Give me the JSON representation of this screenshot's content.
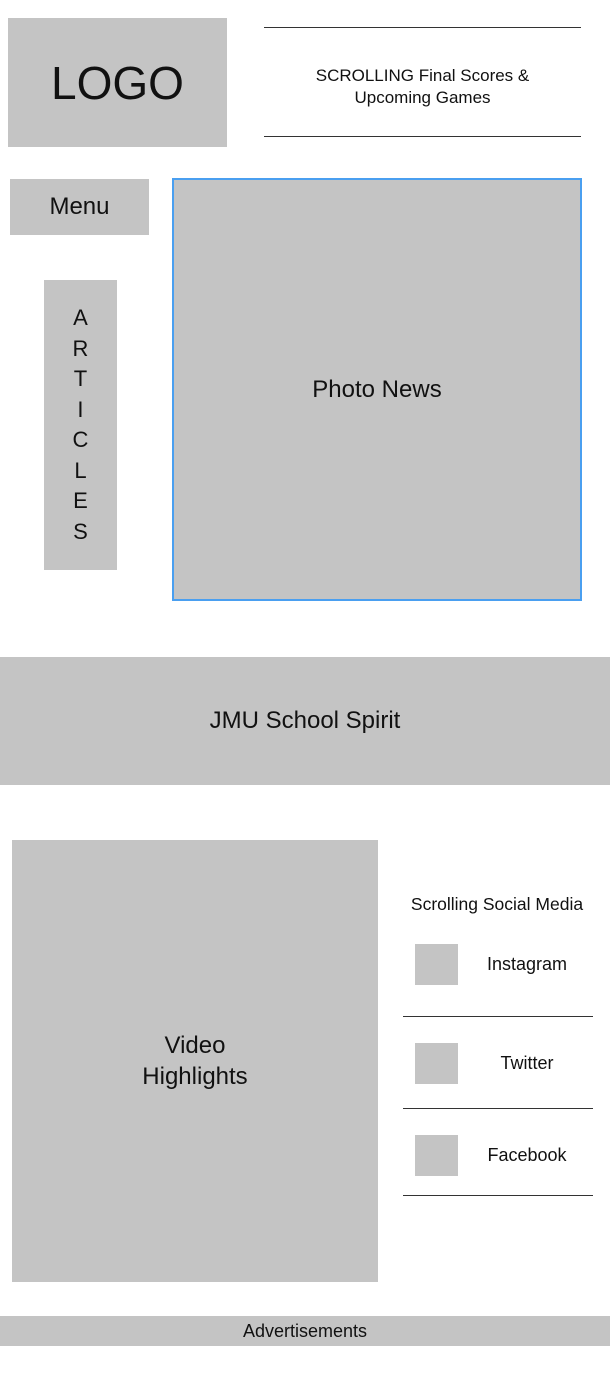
{
  "header": {
    "logo_label": "LOGO",
    "ticker_line1": "SCROLLING Final Scores &",
    "ticker_line2": "Upcoming Games"
  },
  "sidebar": {
    "menu_label": "Menu",
    "articles_label": "ARTICLES"
  },
  "main": {
    "photo_news_label": "Photo News",
    "spirit_label": "JMU School Spirit",
    "video_line1": "Video",
    "video_line2": "Highlights"
  },
  "social": {
    "title": "Scrolling Social Media",
    "items": [
      {
        "label": "Instagram"
      },
      {
        "label": "Twitter"
      },
      {
        "label": "Facebook"
      }
    ]
  },
  "footer": {
    "ads_label": "Advertisements"
  },
  "colors": {
    "placeholder_gray": "#c4c4c4",
    "selection_blue": "#4a9ff0",
    "rule_dark": "#333333"
  }
}
